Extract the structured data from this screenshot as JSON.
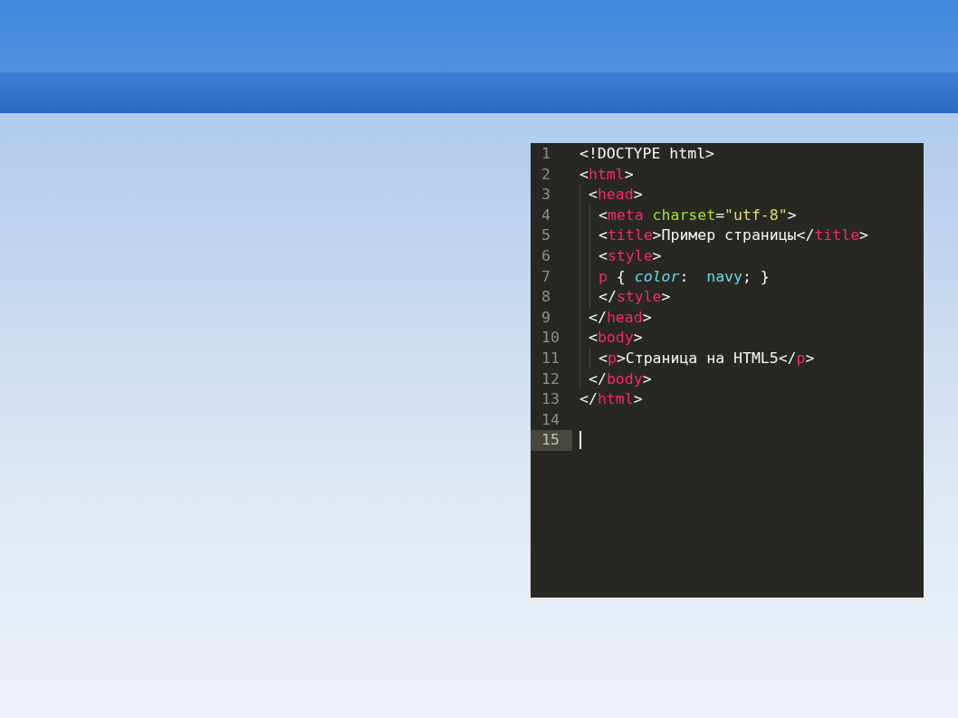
{
  "editor": {
    "lines": [
      {
        "number": "1",
        "current": false,
        "tokens": [
          {
            "kind": "text",
            "text": "<!DOCTYPE html>"
          }
        ]
      },
      {
        "number": "2",
        "current": false,
        "tokens": [
          {
            "kind": "text",
            "text": "<"
          },
          {
            "kind": "tag",
            "text": "html"
          },
          {
            "kind": "text",
            "text": ">"
          }
        ],
        "children": [
          {
            "number": "3",
            "current": false,
            "tokens": [
              {
                "kind": "text",
                "text": "<"
              },
              {
                "kind": "tag",
                "text": "head"
              },
              {
                "kind": "text",
                "text": ">"
              }
            ],
            "children": [
              {
                "number": "4",
                "current": false,
                "tokens": [
                  {
                    "kind": "text",
                    "text": "<"
                  },
                  {
                    "kind": "tag",
                    "text": "meta"
                  },
                  {
                    "kind": "attr",
                    "text": " charset"
                  },
                  {
                    "kind": "text",
                    "text": "="
                  },
                  {
                    "kind": "string",
                    "text": "\"utf-8\""
                  },
                  {
                    "kind": "text",
                    "text": ">"
                  }
                ]
              },
              {
                "number": "5",
                "current": false,
                "tokens": [
                  {
                    "kind": "text",
                    "text": "<"
                  },
                  {
                    "kind": "tag",
                    "text": "title"
                  },
                  {
                    "kind": "text",
                    "text": ">Пример страницы</"
                  },
                  {
                    "kind": "tag",
                    "text": "title"
                  },
                  {
                    "kind": "text",
                    "text": ">"
                  }
                ]
              },
              {
                "number": "6",
                "current": false,
                "tokens": [
                  {
                    "kind": "text",
                    "text": "<"
                  },
                  {
                    "kind": "tag",
                    "text": "style"
                  },
                  {
                    "kind": "text",
                    "text": ">"
                  }
                ]
              },
              {
                "number": "7",
                "current": false,
                "tokens": [
                  {
                    "kind": "tag",
                    "text": "p"
                  },
                  {
                    "kind": "text",
                    "text": " { "
                  },
                  {
                    "kind": "prop",
                    "text": "color"
                  },
                  {
                    "kind": "text",
                    "text": ":  "
                  },
                  {
                    "kind": "value",
                    "text": "navy"
                  },
                  {
                    "kind": "text",
                    "text": "; }"
                  }
                ]
              },
              {
                "number": "8",
                "current": false,
                "tokens": [
                  {
                    "kind": "text",
                    "text": "</"
                  },
                  {
                    "kind": "tag",
                    "text": "style"
                  },
                  {
                    "kind": "text",
                    "text": ">"
                  }
                ]
              }
            ]
          },
          {
            "number": "9",
            "current": false,
            "tokens": [
              {
                "kind": "text",
                "text": "</"
              },
              {
                "kind": "tag",
                "text": "head"
              },
              {
                "kind": "text",
                "text": ">"
              }
            ]
          },
          {
            "number": "10",
            "current": false,
            "tokens": [
              {
                "kind": "text",
                "text": "<"
              },
              {
                "kind": "tag",
                "text": "body"
              },
              {
                "kind": "text",
                "text": ">"
              }
            ],
            "children": [
              {
                "number": "11",
                "current": false,
                "tokens": [
                  {
                    "kind": "text",
                    "text": "<"
                  },
                  {
                    "kind": "tag",
                    "text": "p"
                  },
                  {
                    "kind": "text",
                    "text": ">Страница на HTML5</"
                  },
                  {
                    "kind": "tag",
                    "text": "p"
                  },
                  {
                    "kind": "text",
                    "text": ">"
                  }
                ]
              }
            ]
          },
          {
            "number": "12",
            "current": false,
            "tokens": [
              {
                "kind": "text",
                "text": "</"
              },
              {
                "kind": "tag",
                "text": "body"
              },
              {
                "kind": "text",
                "text": ">"
              }
            ]
          }
        ]
      },
      {
        "number": "13",
        "current": false,
        "tokens": [
          {
            "kind": "text",
            "text": "</"
          },
          {
            "kind": "tag",
            "text": "html"
          },
          {
            "kind": "text",
            "text": ">"
          }
        ]
      },
      {
        "number": "14",
        "current": false
      },
      {
        "number": "15",
        "current": true
      }
    ]
  }
}
